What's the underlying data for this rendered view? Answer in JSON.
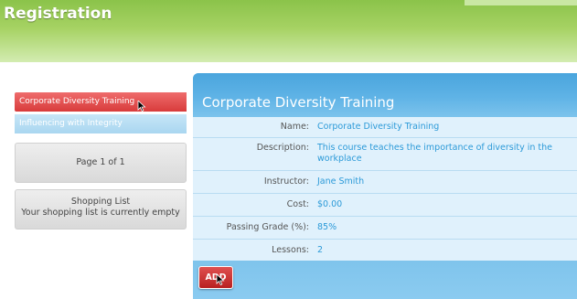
{
  "header": {
    "title": "Registration"
  },
  "courses": [
    {
      "label": "Corporate Diversity Training",
      "state": "active"
    },
    {
      "label": "Influencing with Integrity",
      "state": "inactive"
    }
  ],
  "pagination": {
    "text": "Page 1 of 1"
  },
  "cart": {
    "title": "Shopping List",
    "status": "Your shopping list is currently empty"
  },
  "detail": {
    "title": "Corporate Diversity Training",
    "rows": [
      {
        "label": "Name:",
        "value": "Corporate Diversity Training"
      },
      {
        "label": "Description:",
        "value": "This course teaches the importance of diversity in the workplace"
      },
      {
        "label": "Instructor:",
        "value": "Jane Smith"
      },
      {
        "label": "Cost:",
        "value": "$0.00"
      },
      {
        "label": "Passing Grade (%):",
        "value": "85%"
      },
      {
        "label": "Lessons:",
        "value": "2"
      }
    ],
    "add_label": "ADD"
  },
  "colors": {
    "header_green": "#8bc34a",
    "active_red": "#d83b3b",
    "panel_blue": "#4aa5dd",
    "value_blue": "#2c9ad8"
  }
}
